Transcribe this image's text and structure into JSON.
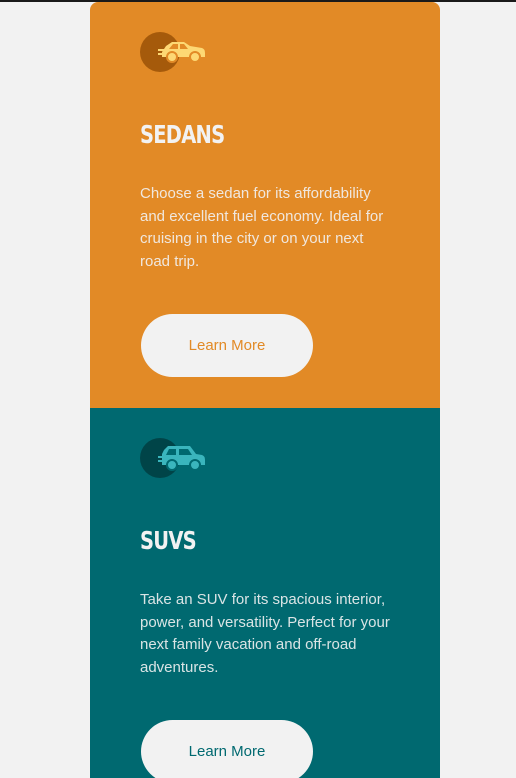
{
  "colors": {
    "sedans_bg": "#e28a26",
    "suvs_bg": "#006970",
    "page_bg": "#f2f2f2",
    "text_light": "#f2f2f2"
  },
  "cards": [
    {
      "id": "sedans",
      "icon": "sedan-car-icon",
      "title": "SEDANS",
      "description": "Choose a sedan for its affordability and excellent fuel economy. Ideal for cruising in the city or on your next road trip.",
      "button_label": "Learn More"
    },
    {
      "id": "suvs",
      "icon": "suv-car-icon",
      "title": "SUVS",
      "description": "Take an SUV for its spacious interior, power, and versatility. Perfect for your next family vacation and off-road adventures.",
      "button_label": "Learn More"
    }
  ]
}
